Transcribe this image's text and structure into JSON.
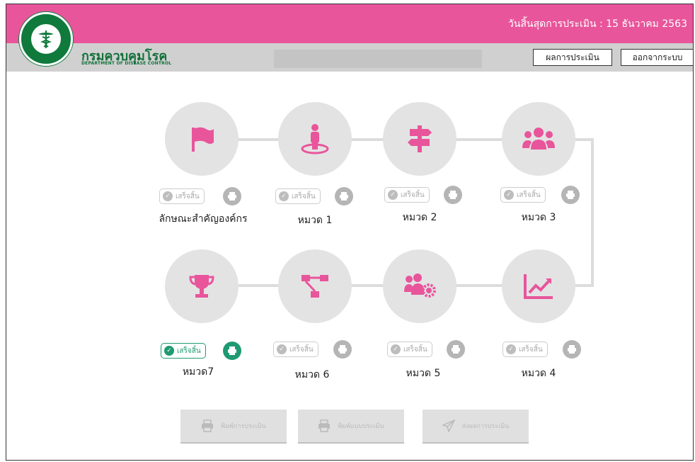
{
  "header": {
    "deadline": "วันสิ้นสุดการประเมิน : 15 ธันวาคม 2563",
    "dept_name_th": "กรมควบคุมโรค",
    "dept_name_en": "DEPARTMENT OF DISEASE CONTROL",
    "results_button": "ผลการประเมิน",
    "logout_button": "ออกจากระบบ"
  },
  "colors": {
    "brand": "#e8559b",
    "dept_green": "#12713a",
    "done_green": "#1f9a72",
    "circle_bg": "#e3e3e3"
  },
  "steps": [
    {
      "label": "ลักษณะสำคัญองค์กร",
      "icon": "flag-icon",
      "status": "เสร็จสิ้น",
      "active": false
    },
    {
      "label": "หมวด 1",
      "icon": "person-target-icon",
      "status": "เสร็จสิ้น",
      "active": false
    },
    {
      "label": "หมวด 2",
      "icon": "signpost-icon",
      "status": "เสร็จสิ้น",
      "active": false
    },
    {
      "label": "หมวด 3",
      "icon": "users-group-icon",
      "status": "เสร็จสิ้น",
      "active": false
    },
    {
      "label": "หมวด 4",
      "icon": "line-chart-icon",
      "status": "เสร็จสิ้น",
      "active": false
    },
    {
      "label": "หมวด 5",
      "icon": "users-gear-icon",
      "status": "เสร็จสิ้น",
      "active": false
    },
    {
      "label": "หมวด 6",
      "icon": "workflow-icon",
      "status": "เสร็จสิ้น",
      "active": false
    },
    {
      "label": "หมวด7",
      "icon": "trophy-icon",
      "status": "เสร็จสิ้น",
      "active": true
    }
  ],
  "bottom_buttons": [
    {
      "label": "พิมพ์การประเมิน",
      "icon": "printer-icon"
    },
    {
      "label": "พิมพ์แบบประเมิน",
      "icon": "printer-icon"
    },
    {
      "label": "ส่งผลการประเมิน",
      "icon": "send-icon"
    }
  ]
}
